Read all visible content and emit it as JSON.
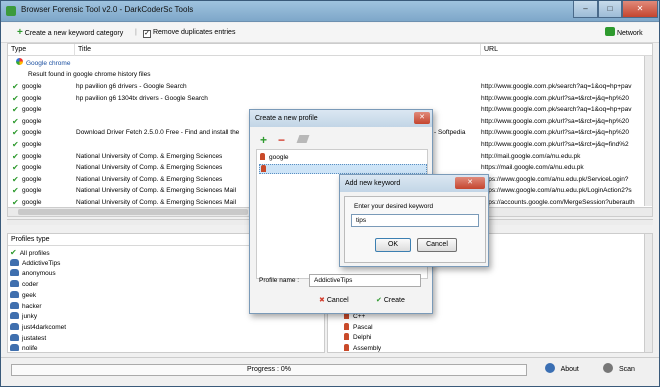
{
  "window": {
    "title": "Browser Forensic Tool v2.0 - DarkCoderSc Tools",
    "min": "–",
    "max": "□",
    "close": "✕"
  },
  "toolbar": {
    "create_label": "Create a new keyword category",
    "remove_dup_label": "Remove duplicates entries",
    "remove_dup_checked": true,
    "network_label": "Network"
  },
  "history": {
    "headers": [
      "Type",
      "Title",
      "URL"
    ],
    "group_label": "Google chrome",
    "result_label": "Result found in google chrome history files",
    "rows": [
      {
        "type": "google",
        "title": "hp pavilion g6 drivers - Google Search",
        "url": "http://www.google.com.pk/search?aq=1&oq=hp+pav"
      },
      {
        "type": "google",
        "title": "hp pavilion g6 1304tx drivers - Google Search",
        "url": "http://www.google.com.pk/url?sa=t&rct=j&q=hp%20"
      },
      {
        "type": "google",
        "title": "",
        "url": "http://www.google.com.pk/search?aq=1&oq=hp+pav"
      },
      {
        "type": "google",
        "title": "",
        "url": "http://www.google.com.pk/url?sa=t&rct=j&q=hp%20"
      },
      {
        "type": "google",
        "title": "Download Driver Fetch 2.5.0.0 Free - Find and install the",
        "title_tail": "- Softpedia",
        "url": "http://www.google.com.pk/url?sa=t&rct=j&q=hp%20"
      },
      {
        "type": "google",
        "title": "",
        "url": "http://www.google.com.pk/url?sa=t&rct=j&q=find%2"
      },
      {
        "type": "google",
        "title": "National University of Comp. & Emerging Sciences",
        "url": "http://mail.google.com/a/nu.edu.pk"
      },
      {
        "type": "google",
        "title": "National University of Comp. & Emerging Sciences",
        "url": "https://mail.google.com/a/nu.edu.pk"
      },
      {
        "type": "google",
        "title": "National University of Comp. & Emerging Sciences",
        "url": "https://www.google.com/a/nu.edu.pk/ServiceLogin?"
      },
      {
        "type": "google",
        "title": "National University of Comp. & Emerging Sciences Mail",
        "url": "https://www.google.com/a/nu.edu.pk/LoginAction2?s"
      },
      {
        "type": "google",
        "title": "National University of Comp. & Emerging Sciences Mail",
        "url": "https://accounts.google.com/MergeSession?uberauth"
      }
    ]
  },
  "profiles": {
    "header": "Profiles type",
    "items": [
      "All profiles",
      "AddictiveTips",
      "anonymous",
      "coder",
      "geek",
      "hacker",
      "junky",
      "just4darkcomet",
      "justatest",
      "nolife"
    ]
  },
  "keywords": {
    "items": [
      "C++",
      "Pascal",
      "Delphi",
      "Assembly"
    ]
  },
  "status": {
    "progress_label": "Progress : 0%",
    "progress": 0,
    "about_label": "About",
    "scan_label": "Scan"
  },
  "dialog_profile": {
    "title": "Create a new profile",
    "close": "✕",
    "list": [
      "google",
      ""
    ],
    "name_label": "Profile name :",
    "name_value": "AddictiveTips",
    "cancel_label": "Cancel",
    "create_label": "Create"
  },
  "dialog_keyword": {
    "title": "Add new keyword",
    "close": "✕",
    "prompt": "Enter your desired keyword",
    "value": "tips",
    "ok_label": "OK",
    "cancel_label": "Cancel"
  },
  "colors": {
    "accent": "#2e9a2e",
    "close_red": "#c4452f",
    "selection": "#cde4f7"
  }
}
